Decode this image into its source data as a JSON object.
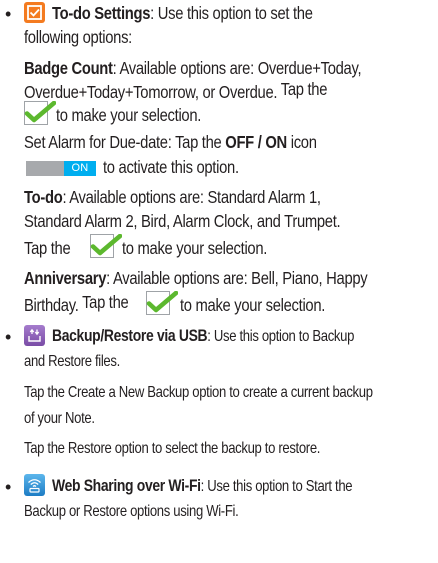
{
  "todo": {
    "bullet": "•",
    "title": "To-do Settings",
    "intro_1": ": Use this option to set the",
    "intro_2": "following options:",
    "badge_label": "Badge Count",
    "badge_1": ": Available options are: Overdue+Today,",
    "badge_2a": "Overdue+Today+Tomorrow, or Overdue.",
    "badge_2b": " Tap the",
    "badge_3": " to make your selection.",
    "alarm_1a": "Set Alarm for Due-date: Tap the ",
    "alarm_1b": "OFF / ON",
    "alarm_1c": " icon",
    "alarm_toggle_label": "ON",
    "alarm_2": "to activate this option.",
    "todo_label": "To-do",
    "todo_1": ": Available options are: Standard Alarm 1,",
    "todo_2": "Standard Alarm 2, Bird, Alarm Clock, and Trumpet.",
    "todo_3a": "Tap the",
    "todo_3b": " to make your selection.",
    "anniv_label": "Anniversary",
    "anniv_1": ": Available options are: Bell, Piano, Happy",
    "anniv_2a": "Birthday.",
    "anniv_2b": " Tap the",
    "anniv_2c": " to make your selection."
  },
  "backup": {
    "bullet": "•",
    "title": "Backup/Restore via USB",
    "line_1": ": Use this option to Backup",
    "line_2": "and Restore files.",
    "line_3": "Tap the Create a New Backup option to create a current backup",
    "line_4": "of your Note.",
    "line_5": "Tap the Restore option to select the backup to restore."
  },
  "web": {
    "bullet": "•",
    "title": "Web Sharing over Wi-Fi",
    "line_1": ": Use this option to Start the",
    "line_2": "Backup or Restore options using Wi-Fi."
  },
  "colors": {
    "icon_orange": "#f47b20",
    "icon_purple": "#8d5fb4",
    "icon_blue": "#2a8fd4",
    "check_green": "#5cb82e",
    "toggle_on": "#00aeef",
    "toggle_off": "#a7a9ac",
    "text": "#231f20"
  },
  "icons": [
    "todo-settings-icon",
    "checkmark-icon",
    "toggle-icon",
    "backup-usb-icon",
    "web-sharing-wifi-icon"
  ]
}
